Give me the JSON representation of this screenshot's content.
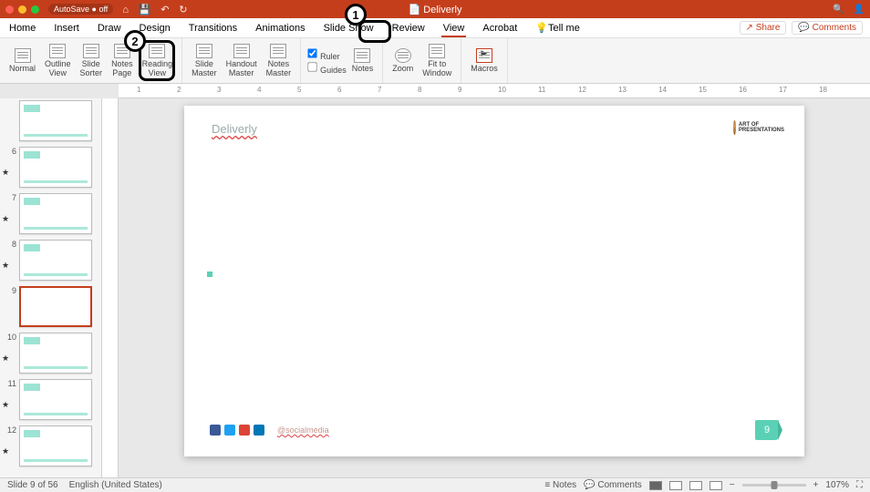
{
  "title_bar": {
    "autosave_label": "AutoSave ● off",
    "doc_name": "Deliverly"
  },
  "tabs": {
    "home": "Home",
    "insert": "Insert",
    "draw": "Draw",
    "design": "Design",
    "transitions": "Transitions",
    "animations": "Animations",
    "slideshow": "Slide Show",
    "review": "Review",
    "view": "View",
    "acrobat": "Acrobat",
    "tellme": "Tell me",
    "share": "Share",
    "comments": "Comments"
  },
  "ribbon": {
    "normal": "Normal",
    "outline": "Outline\nView",
    "sorter": "Slide\nSorter",
    "notespage": "Notes\nPage",
    "reading": "Reading\nView",
    "slide_master": "Slide\nMaster",
    "handout_master": "Handout\nMaster",
    "notes_master": "Notes\nMaster",
    "ruler": "Ruler",
    "guides": "Guides",
    "notes": "Notes",
    "zoom": "Zoom",
    "fit": "Fit to\nWindow",
    "macros": "Macros"
  },
  "thumbs": {
    "visible": [
      {
        "num": "",
        "star": false,
        "selected": false
      },
      {
        "num": "6",
        "star": true,
        "selected": false
      },
      {
        "num": "7",
        "star": true,
        "selected": false
      },
      {
        "num": "8",
        "star": true,
        "selected": false
      },
      {
        "num": "9",
        "star": false,
        "selected": true
      },
      {
        "num": "10",
        "star": true,
        "selected": false
      },
      {
        "num": "11",
        "star": true,
        "selected": false
      },
      {
        "num": "12",
        "star": true,
        "selected": false
      }
    ]
  },
  "slide": {
    "title": "Deliverly",
    "social_handle": "@socialmedia",
    "page_num": "9",
    "logo_text": "ART OF\nPRESENTATIONS"
  },
  "status": {
    "slide_pos": "Slide 9 of 56",
    "language": "English (United States)",
    "notes_btn": "Notes",
    "comments_btn": "Comments",
    "zoom_pct": "107%"
  },
  "ruler_ticks": [
    "1",
    "2",
    "3",
    "4",
    "5",
    "6",
    "7",
    "8",
    "9",
    "10",
    "11",
    "12",
    "13",
    "14",
    "15",
    "16",
    "17",
    "18"
  ],
  "callouts": {
    "one": "1",
    "two": "2"
  }
}
